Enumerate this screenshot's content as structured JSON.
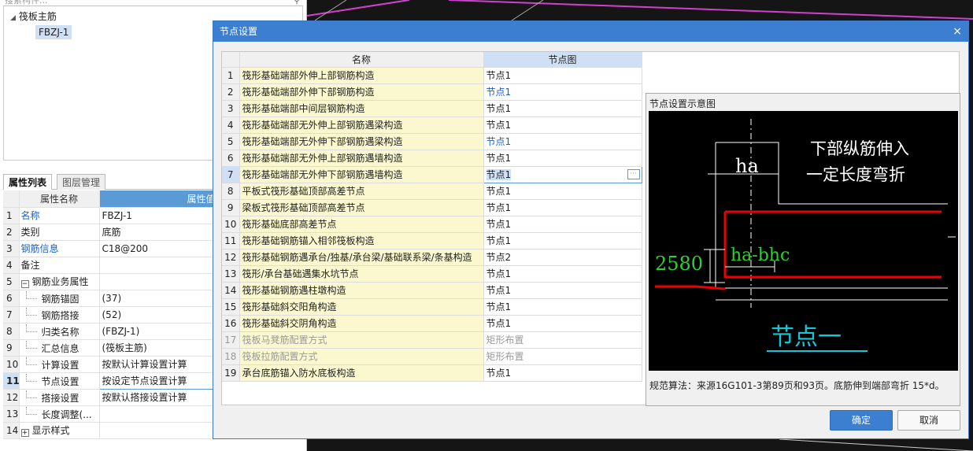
{
  "left_panel": {
    "search_placeholder": "搜索构件...",
    "tree": {
      "root": "筏板主筋",
      "child": "FBZJ-1"
    },
    "tabs": [
      "属性列表",
      "图层管理"
    ],
    "table": {
      "headers": [
        "属性名称",
        "属性值"
      ],
      "rows": [
        {
          "num": "1",
          "name": "名称",
          "value": "FBZJ-1"
        },
        {
          "num": "2",
          "name": "类别",
          "value": "底筋"
        },
        {
          "num": "3",
          "name": "钢筋信息",
          "value": "C18@200"
        },
        {
          "num": "4",
          "name": "备注",
          "value": ""
        },
        {
          "num": "5",
          "name": "钢筋业务属性",
          "value": "",
          "box": "−"
        },
        {
          "num": "6",
          "name": "钢筋锚固",
          "value": "(37)"
        },
        {
          "num": "7",
          "name": "钢筋搭接",
          "value": "(52)"
        },
        {
          "num": "8",
          "name": "归类名称",
          "value": "(FBZJ-1)"
        },
        {
          "num": "9",
          "name": "汇总信息",
          "value": "(筏板主筋)"
        },
        {
          "num": "10",
          "name": "计算设置",
          "value": "按默认计算设置计算"
        },
        {
          "num": "11",
          "name": "节点设置",
          "value": "按设定节点设置计算"
        },
        {
          "num": "12",
          "name": "搭接设置",
          "value": "按默认搭接设置计算"
        },
        {
          "num": "13",
          "name": "长度调整(...",
          "value": ""
        },
        {
          "num": "14",
          "name": "显示样式",
          "value": "",
          "box": "+"
        }
      ]
    }
  },
  "dialog": {
    "title": "节点设置",
    "close_icon": "×",
    "grid": {
      "headers": [
        "名称",
        "节点图"
      ],
      "rows": [
        {
          "num": "1",
          "name": "筏形基础端部外伸上部钢筋构造",
          "node": "节点1"
        },
        {
          "num": "2",
          "name": "筏形基础端部外伸下部钢筋构造",
          "node": "节点1"
        },
        {
          "num": "3",
          "name": "筏形基础端部中间层钢筋构造",
          "node": "节点1"
        },
        {
          "num": "4",
          "name": "筏形基础端部无外伸上部钢筋遇梁构造",
          "node": "节点1"
        },
        {
          "num": "5",
          "name": "筏形基础端部无外伸下部钢筋遇梁构造",
          "node": "节点1"
        },
        {
          "num": "6",
          "name": "筏形基础端部无外伸上部钢筋遇墙构造",
          "node": "节点1"
        },
        {
          "num": "7",
          "name": "筏形基础端部无外伸下部钢筋遇墙构造",
          "node": "节点1"
        },
        {
          "num": "8",
          "name": "平板式筏形基础顶部高差节点",
          "node": "节点1"
        },
        {
          "num": "9",
          "name": "梁板式筏形基础顶部高差节点",
          "node": "节点1"
        },
        {
          "num": "10",
          "name": "筏形基础底部高差节点",
          "node": "节点1"
        },
        {
          "num": "11",
          "name": "筏形基础钢筋锚入相邻筏板构造",
          "node": "节点1"
        },
        {
          "num": "12",
          "name": "筏形基础钢筋遇承台/独基/承台梁/基础联系梁/条基构造",
          "node": "节点2"
        },
        {
          "num": "13",
          "name": "筏形/承台基础遇集水坑节点",
          "node": "节点1"
        },
        {
          "num": "14",
          "name": "筏形基础钢筋遇柱墩构造",
          "node": "节点1"
        },
        {
          "num": "15",
          "name": "筏形基础斜交阳角构造",
          "node": "节点1"
        },
        {
          "num": "16",
          "name": "筏形基础斜交阴角构造",
          "node": "节点1"
        },
        {
          "num": "17",
          "name": "筏板马凳筋配置方式",
          "node": "矩形布置"
        },
        {
          "num": "18",
          "name": "筏板拉筋配置方式",
          "node": "矩形布置"
        },
        {
          "num": "19",
          "name": "承台底筋锚入防水底板构造",
          "node": "节点1"
        }
      ]
    },
    "preview": {
      "title": "节点设置示意图",
      "labels": {
        "ha": "ha",
        "text1": "下部纵筋伸入",
        "text2": "一定长度弯折",
        "dim": "2580",
        "hab": "ha-bhc",
        "caption": "节点一"
      },
      "desc": "规范算法：来源16G101-3第89页和93页。底筋伸到端部弯折 15*d。"
    },
    "ok_label": "确定",
    "cancel_label": "取消"
  }
}
